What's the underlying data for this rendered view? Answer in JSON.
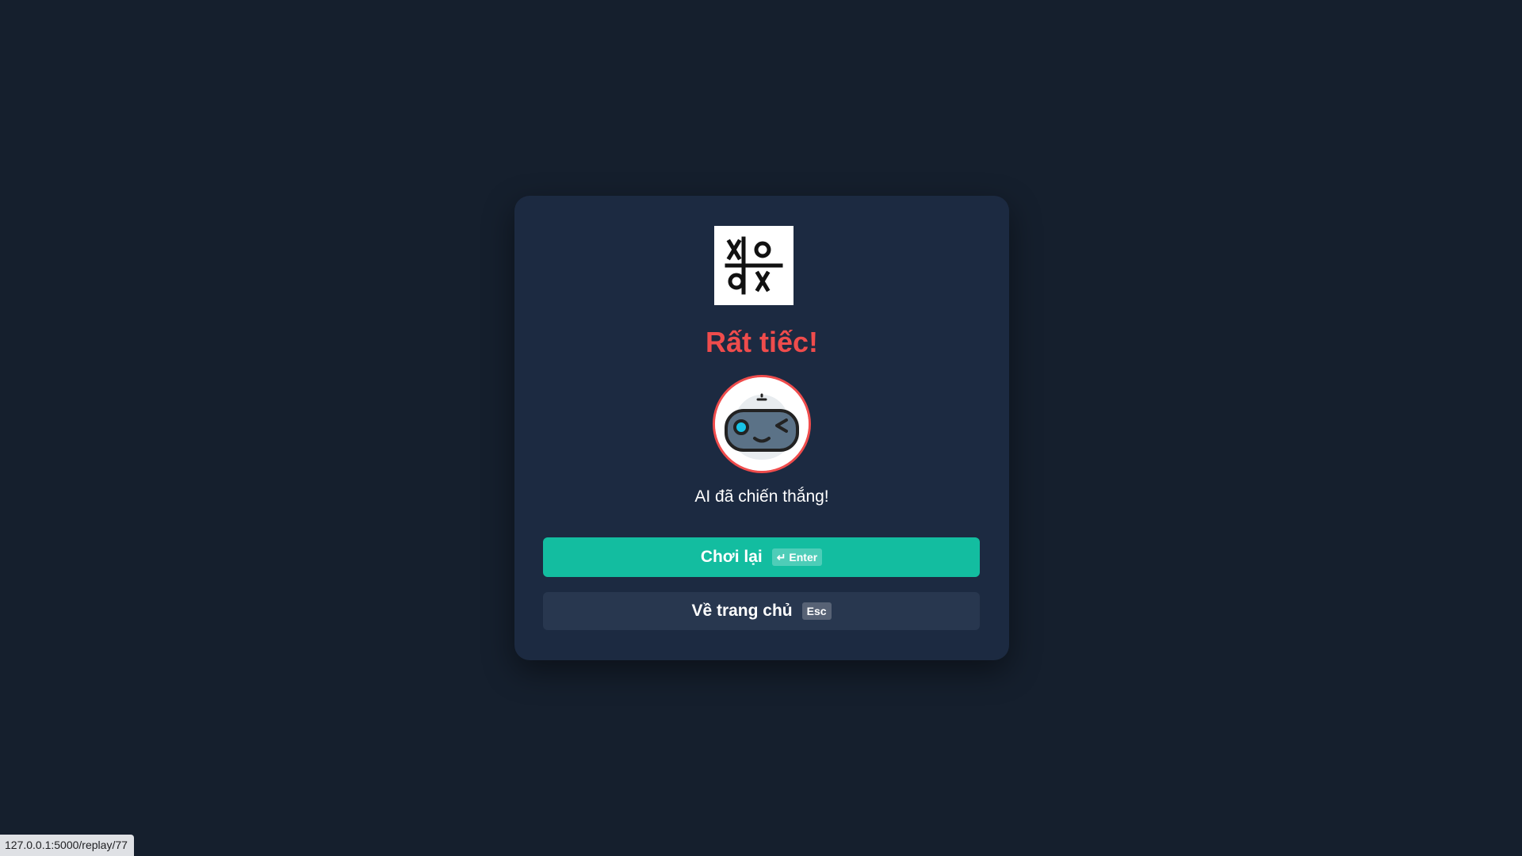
{
  "result": {
    "title": "Rất tiếc!",
    "message": "AI đã chiến thắng!"
  },
  "buttons": {
    "play_again": {
      "label": "Chơi lại",
      "shortcut": "↵ Enter"
    },
    "home": {
      "label": "Về trang chủ",
      "shortcut": "Esc"
    }
  },
  "status_bar": {
    "url": "127.0.0.1:5000/replay/77"
  },
  "colors": {
    "background": "#151f2d",
    "card": "#1c2a41",
    "lose_red": "#ef4c4c",
    "primary_button": "#13bda0",
    "secondary_button": "#28374f"
  },
  "icons": {
    "logo": "tic-tac-toe-logo",
    "avatar": "winking-robot-avatar"
  }
}
